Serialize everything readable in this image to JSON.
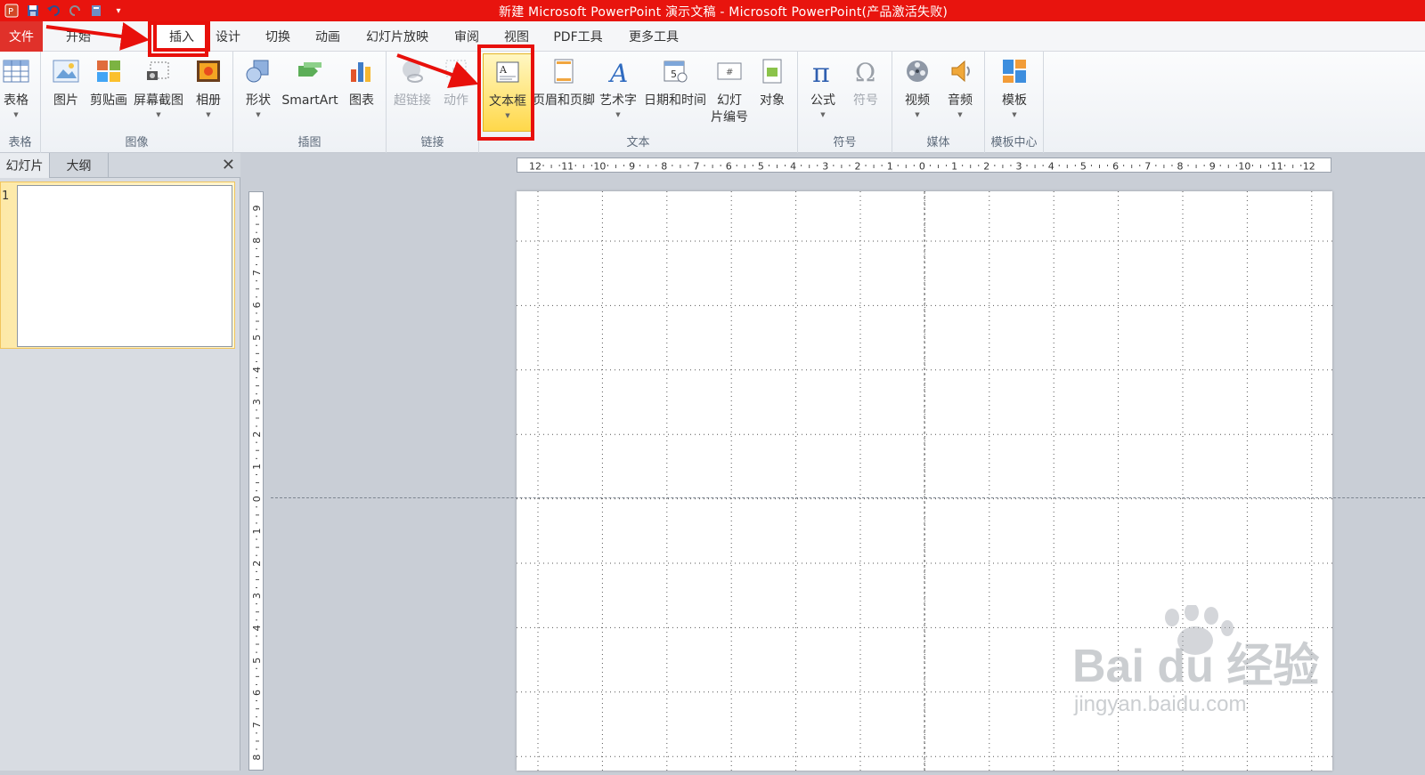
{
  "window": {
    "title": "新建 Microsoft PowerPoint 演示文稿 - Microsoft PowerPoint(产品激活失败)"
  },
  "quick_access": {
    "icons": [
      "powerpoint-icon",
      "save-icon",
      "undo-icon",
      "redo-icon",
      "repeat-icon",
      "customize-icon"
    ]
  },
  "tabs": [
    {
      "label": "文件"
    },
    {
      "label": "开始"
    },
    {
      "label": "插入"
    },
    {
      "label": "设计"
    },
    {
      "label": "切换"
    },
    {
      "label": "动画"
    },
    {
      "label": "幻灯片放映"
    },
    {
      "label": "审阅"
    },
    {
      "label": "视图"
    },
    {
      "label": "PDF工具"
    },
    {
      "label": "更多工具"
    }
  ],
  "ribbon": {
    "groups": {
      "tables": {
        "label": "表格",
        "buttons": [
          {
            "label": "表格"
          }
        ]
      },
      "images": {
        "label": "图像",
        "buttons": [
          {
            "label": "图片"
          },
          {
            "label": "剪贴画"
          },
          {
            "label": "屏幕截图"
          },
          {
            "label": "相册"
          }
        ]
      },
      "illustrations": {
        "label": "插图",
        "buttons": [
          {
            "label": "形状"
          },
          {
            "label": "SmartArt"
          },
          {
            "label": "图表"
          }
        ]
      },
      "links": {
        "label": "链接",
        "buttons": [
          {
            "label": "超链接"
          },
          {
            "label": "动作"
          }
        ]
      },
      "text": {
        "label": "文本",
        "buttons": [
          {
            "label": "文本框"
          },
          {
            "label": "页眉和页脚"
          },
          {
            "label": "艺术字"
          },
          {
            "label": "日期和时间"
          },
          {
            "label": "幻灯\n片编号"
          },
          {
            "label": "对象"
          }
        ]
      },
      "symbols": {
        "label": "符号",
        "buttons": [
          {
            "label": "公式"
          },
          {
            "label": "符号"
          }
        ]
      },
      "media": {
        "label": "媒体",
        "buttons": [
          {
            "label": "视频"
          },
          {
            "label": "音频"
          }
        ]
      },
      "templates": {
        "label": "模板中心",
        "buttons": [
          {
            "label": "模板"
          }
        ]
      }
    }
  },
  "left_pane": {
    "tabs": [
      {
        "label": "幻灯片"
      },
      {
        "label": "大纲"
      }
    ],
    "close": "✕",
    "slides": [
      {
        "number": "1"
      }
    ]
  },
  "rulers": {
    "horizontal": [
      "12",
      "11",
      "10",
      "9",
      "8",
      "7",
      "6",
      "5",
      "4",
      "3",
      "2",
      "1",
      "0",
      "1",
      "2",
      "3",
      "4",
      "5",
      "6",
      "7",
      "8",
      "9",
      "10",
      "11",
      "12"
    ],
    "vertical": [
      "9",
      "8",
      "7",
      "6",
      "5",
      "4",
      "3",
      "2",
      "1",
      "0",
      "1",
      "2",
      "3",
      "4",
      "5",
      "6",
      "7",
      "8"
    ]
  },
  "watermark": {
    "main": "Bai du 经验",
    "sub": "jingyan.baidu.com"
  },
  "colors": {
    "titlebar": "#e8140e",
    "highlight": "#e8100b",
    "selected_button": "#ffd84a"
  }
}
